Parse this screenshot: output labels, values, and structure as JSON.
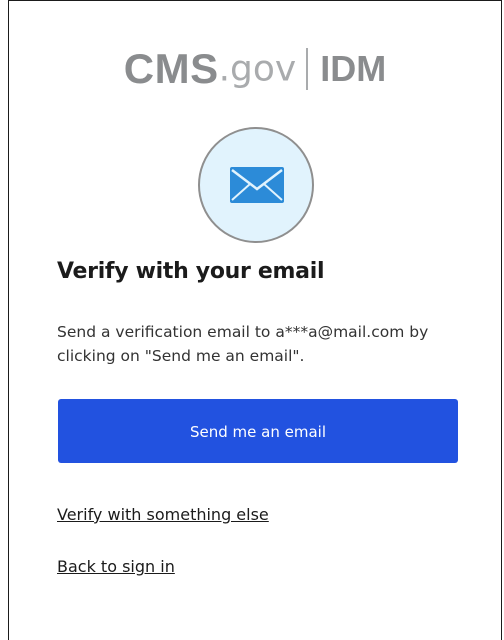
{
  "logo": {
    "cms": "CMS",
    "gov": ".gov",
    "idm": "IDM"
  },
  "icon": {
    "name": "envelope-icon",
    "color": "#2c8bd8",
    "circle_background": "#e1f3fd"
  },
  "page": {
    "title": "Verify with your email",
    "description": "Send a verification email to a***a@mail.com by clicking on \"Send me an email\"."
  },
  "actions": {
    "send_label": "Send me an email",
    "send_color": "#2252e0",
    "verify_other_label": "Verify with something else",
    "back_label": "Back to sign in"
  }
}
